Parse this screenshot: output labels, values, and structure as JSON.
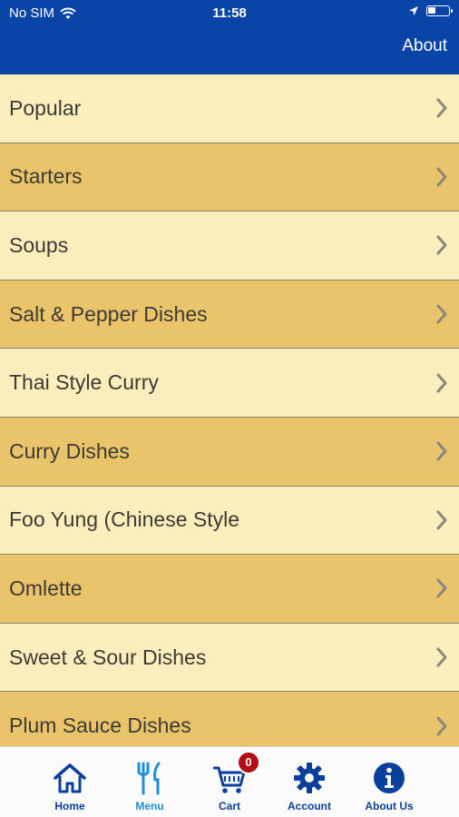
{
  "status_bar": {
    "carrier": "No SIM",
    "time": "11:58"
  },
  "header": {
    "about_label": "About"
  },
  "menu": {
    "items": [
      {
        "label": "Popular"
      },
      {
        "label": "Starters"
      },
      {
        "label": "Soups"
      },
      {
        "label": "Salt & Pepper Dishes"
      },
      {
        "label": "Thai Style Curry"
      },
      {
        "label": "Curry Dishes"
      },
      {
        "label": "Foo Yung (Chinese Style"
      },
      {
        "label": "Omlette"
      },
      {
        "label": "Sweet & Sour Dishes"
      },
      {
        "label": "Plum Sauce Dishes"
      }
    ]
  },
  "tabbar": {
    "tabs": [
      {
        "label": "Home",
        "icon": "home-icon"
      },
      {
        "label": "Menu",
        "icon": "fork-knife-icon",
        "active": true
      },
      {
        "label": "Cart",
        "icon": "cart-icon",
        "badge": "0"
      },
      {
        "label": "Account",
        "icon": "gear-icon"
      },
      {
        "label": "About Us",
        "icon": "info-icon"
      }
    ]
  },
  "colors": {
    "header": "#0a44a6",
    "row_light": "#fbeebd",
    "row_dark": "#e9c46b",
    "tab_icon": "#0a3f9c",
    "tab_active": "#1d8fd8",
    "badge": "#b10f12"
  }
}
